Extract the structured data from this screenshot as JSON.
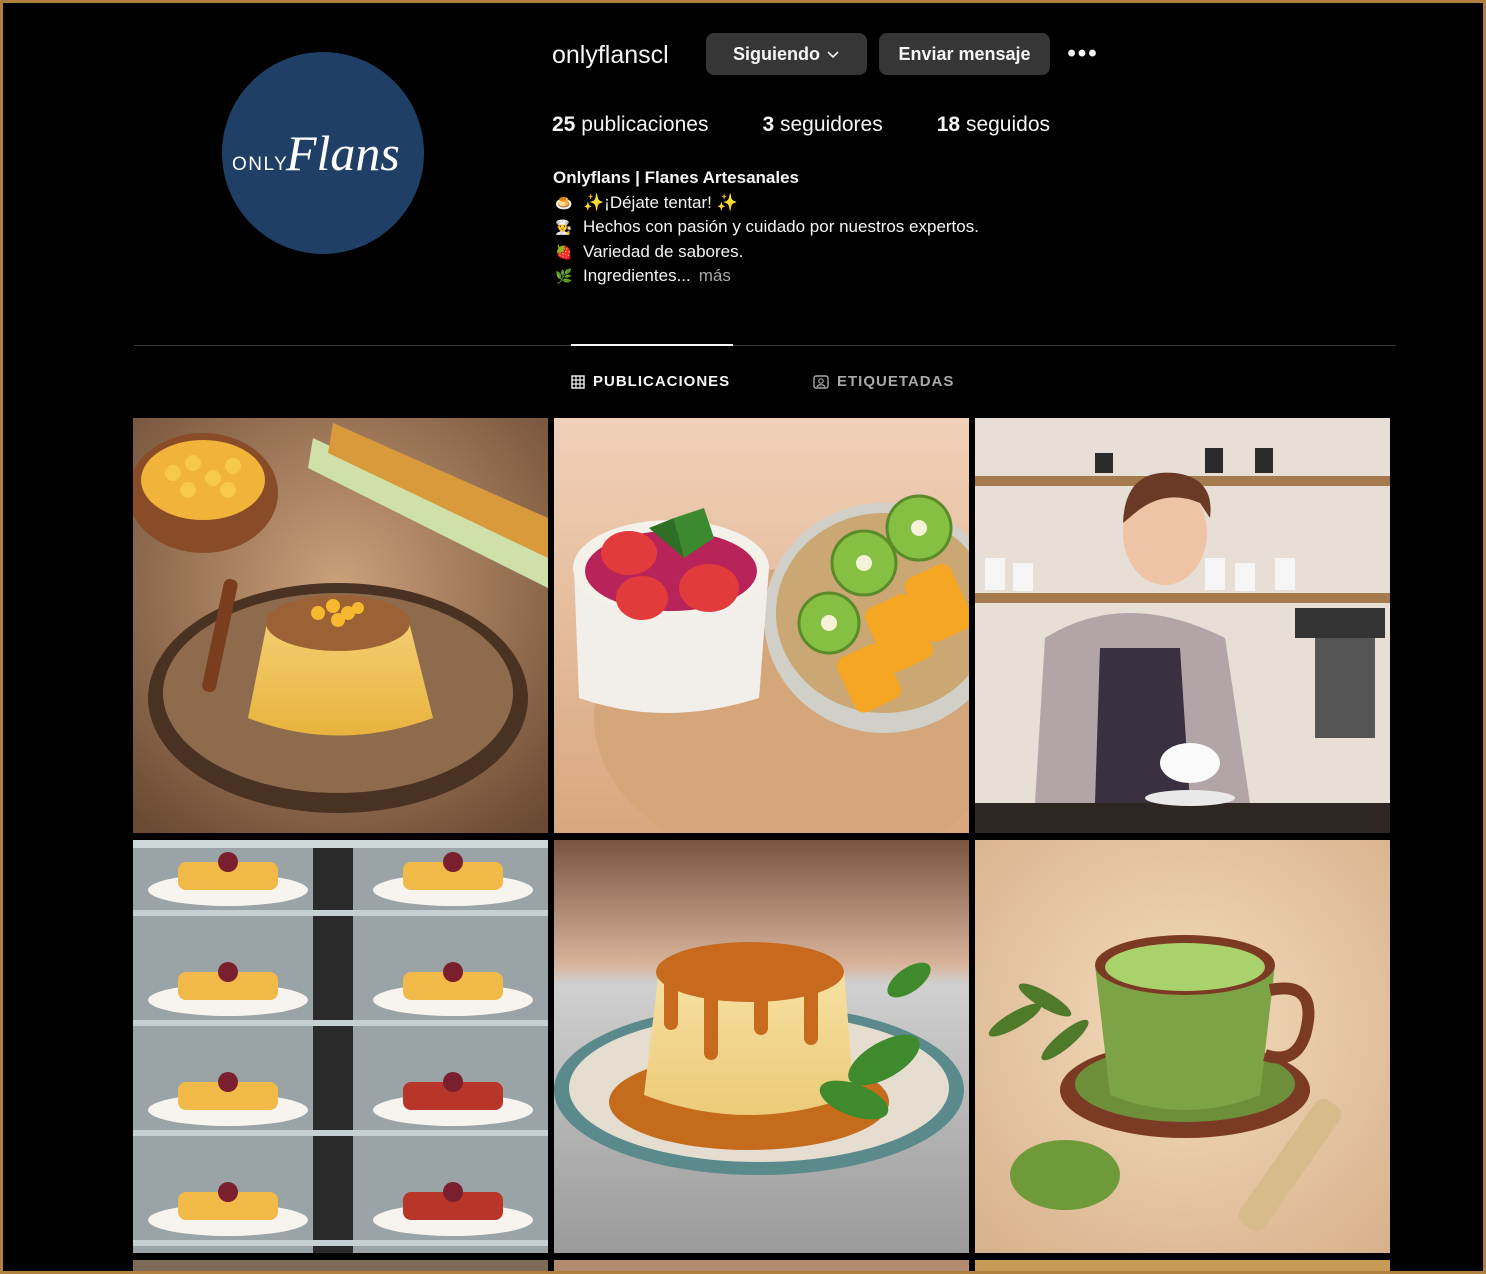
{
  "profile": {
    "username": "onlyflanscl",
    "logo": {
      "small": "ONLY",
      "script": "Flans",
      "color": "#1f3f66"
    },
    "actions": {
      "following": "Siguiendo",
      "message": "Enviar mensaje",
      "more": "•••"
    },
    "stats": {
      "posts_count": "25",
      "posts_label": "publicaciones",
      "followers_count": "3",
      "followers_label": "seguidores",
      "following_count": "18",
      "following_label": "seguidos"
    },
    "bio": {
      "name": "Onlyflans | Flanes Artesanales",
      "lines": [
        {
          "emoji": "🍮",
          "text": "✨¡Déjate tentar! ✨"
        },
        {
          "emoji": "👨‍🍳",
          "text": "Hechos con pasión y cuidado por nuestros expertos."
        },
        {
          "emoji": "🍓",
          "text": "Variedad de sabores."
        },
        {
          "emoji": "🌿",
          "text": "Ingredientes..."
        }
      ],
      "more": "más"
    }
  },
  "tabs": [
    {
      "label": "PUBLICACIONES",
      "icon": "grid-icon",
      "active": true
    },
    {
      "label": "ETIQUETADAS",
      "icon": "tag-person-icon",
      "active": false
    }
  ],
  "posts": [
    {
      "subject": "corn-flan-photo"
    },
    {
      "subject": "berry-kiwi-mango-photo"
    },
    {
      "subject": "barista-woman-photo"
    },
    {
      "subject": "flan-display-case-photo"
    },
    {
      "subject": "caramel-flan-photo"
    },
    {
      "subject": "matcha-cup-photo"
    }
  ],
  "colors": {
    "background": "#000000",
    "button": "#363636",
    "frame": "#b0803e",
    "muted": "#a8a8a8"
  }
}
